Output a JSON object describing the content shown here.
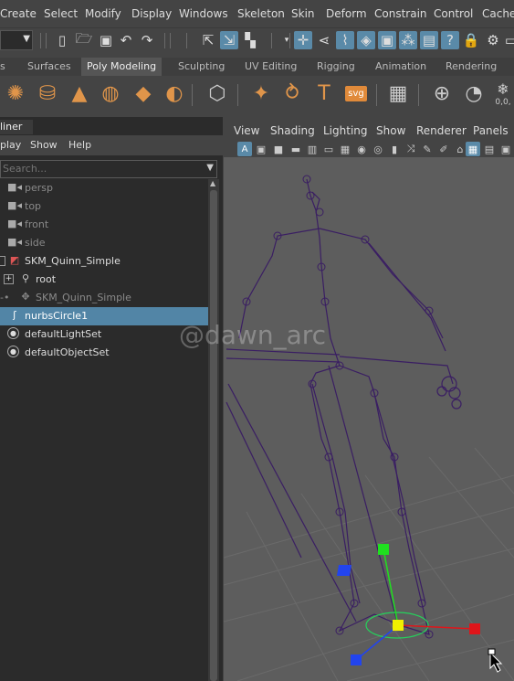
{
  "menubar": {
    "items": [
      "Create",
      "Select",
      "Modify",
      "Display",
      "Windows",
      "Skeleton",
      "Skin",
      "Deform",
      "Constrain",
      "Control",
      "Cache"
    ]
  },
  "shelf": {
    "tabs": [
      "s",
      "Surfaces",
      "Poly Modeling",
      "Sculpting",
      "UV Editing",
      "Rigging",
      "Animation",
      "Rendering"
    ],
    "active_tab": "Poly Modeling",
    "text_icon_label": "svg",
    "coord_readout": "0,0,"
  },
  "outliner": {
    "title": "liner",
    "menus": [
      "play",
      "Show",
      "Help"
    ],
    "search_placeholder": "Search...",
    "items": [
      {
        "label": "persp",
        "icon": "camera-icon",
        "dim": true
      },
      {
        "label": "top",
        "icon": "camera-icon",
        "dim": true
      },
      {
        "label": "front",
        "icon": "camera-icon",
        "dim": true
      },
      {
        "label": "side",
        "icon": "camera-icon",
        "dim": true
      },
      {
        "label": "SKM_Quinn_Simple",
        "icon": "mesh-icon",
        "dim": false
      },
      {
        "label": "root",
        "icon": "joint-icon",
        "dim": false
      },
      {
        "label": "SKM_Quinn_Simple",
        "icon": "skin-cluster-icon",
        "dim": true
      },
      {
        "label": "nurbsCircle1",
        "icon": "nurbs-curve-icon",
        "dim": false,
        "selected": true
      },
      {
        "label": "defaultLightSet",
        "icon": "set-icon",
        "dim": false
      },
      {
        "label": "defaultObjectSet",
        "icon": "set-icon",
        "dim": false
      }
    ]
  },
  "viewport": {
    "menus": [
      "View",
      "Shading",
      "Lighting",
      "Show",
      "Renderer",
      "Panels"
    ],
    "watermark": "@dawn_arc",
    "colors": {
      "background": "#5d5d5d",
      "skeleton": "#3a1e63",
      "grid": "#6a6a6a",
      "axis_x": "#e0151a",
      "axis_y": "#1fe01f",
      "axis_z": "#2244ee",
      "manip_center": "#f0f000",
      "circle": "#25d25c"
    }
  }
}
